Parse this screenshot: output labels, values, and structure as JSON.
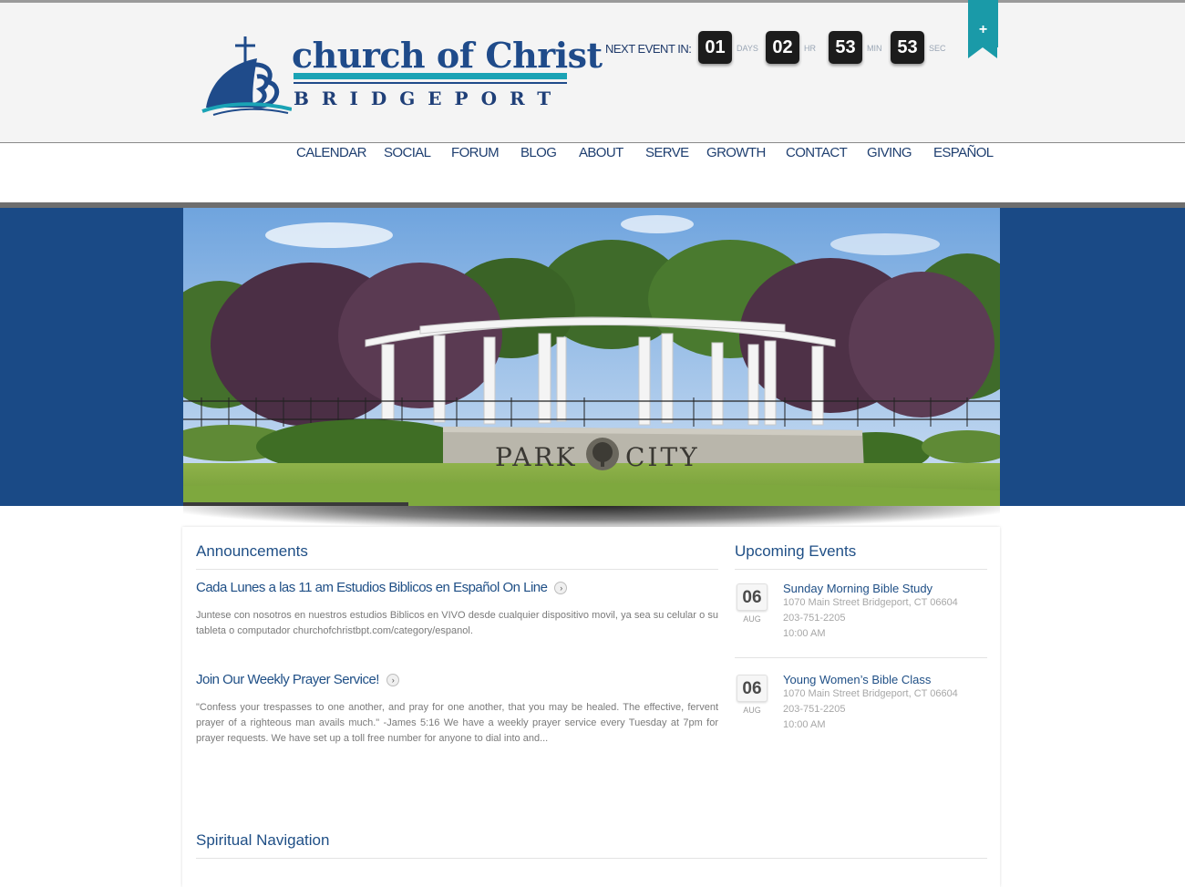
{
  "logo": {
    "title": "church of Christ",
    "subtitle": "BRIDGEPORT"
  },
  "countdown": {
    "label": "NEXT EVENT IN:",
    "days": "01",
    "days_unit": "DAYS",
    "hours": "02",
    "hours_unit": "HR",
    "minutes": "53",
    "minutes_unit": "MIN",
    "seconds": "53",
    "seconds_unit": "SEC"
  },
  "ribbon": {
    "label": "+"
  },
  "nav": {
    "items": [
      {
        "label": "CALENDAR"
      },
      {
        "label": "SOCIAL"
      },
      {
        "label": "FORUM"
      },
      {
        "label": "BLOG"
      },
      {
        "label": "ABOUT"
      },
      {
        "label": "SERVE"
      },
      {
        "label": "GROWTH"
      },
      {
        "label": "CONTACT"
      },
      {
        "label": "GIVING"
      },
      {
        "label": "ESPAÑOL"
      }
    ]
  },
  "hero": {
    "sign_left": "PARK",
    "sign_right": "CITY"
  },
  "announcements": {
    "title": "Announcements",
    "posts": [
      {
        "title": "Cada Lunes a las 11 am Estudios Biblicos en Español On Line",
        "body": "Juntese con nosotros en nuestros estudios Biblicos en VIVO desde cualquier dispositivo movil, ya sea su celular o su tableta o computador churchofchristbpt.com/category/espanol."
      },
      {
        "title": "Join Our Weekly Prayer Service!",
        "body": "\"Confess your trespasses to one another, and pray for one another, that you may be healed. The effective, fervent prayer of a righteous man avails much.\" -James 5:16 We have a weekly prayer service every Tuesday at 7pm for prayer requests. We have set up a toll free number for anyone to dial into and..."
      }
    ]
  },
  "events": {
    "title": "Upcoming Events",
    "items": [
      {
        "day": "06",
        "month": "AUG",
        "title": "Sunday Morning Bible Study",
        "address": "1070 Main Street Bridgeport, CT 06604",
        "phone": "203-751-2205",
        "time": "10:00 AM"
      },
      {
        "day": "06",
        "month": "AUG",
        "title": "Young Women’s Bible Class",
        "address": "1070 Main Street Bridgeport, CT 06604",
        "phone": "203-751-2205",
        "time": "10:00 AM"
      }
    ]
  },
  "spiritual": {
    "title": "Spiritual Navigation"
  },
  "colors": {
    "brand_blue": "#1f4f86",
    "teal": "#1a9aa8",
    "hero_bg": "#1a4a86"
  }
}
